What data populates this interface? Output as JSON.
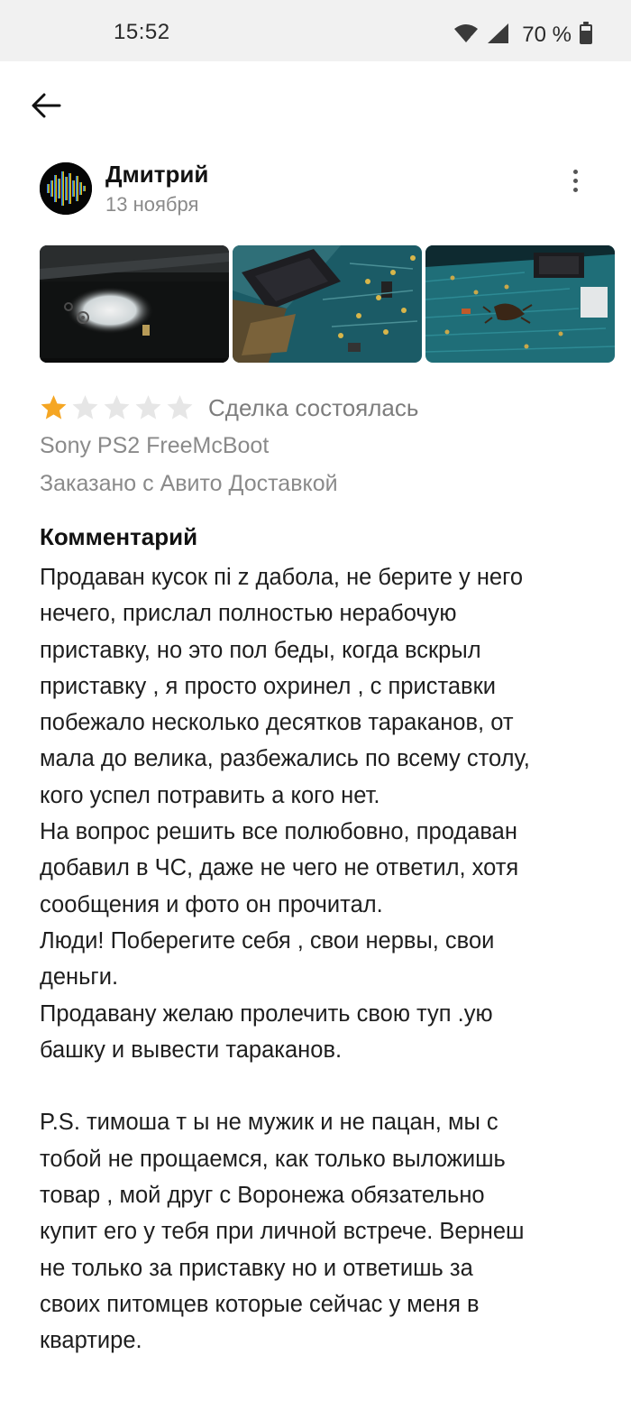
{
  "status_bar": {
    "time": "15:52",
    "battery": "70 %"
  },
  "review": {
    "author": "Дмитрий",
    "date": "13 ноября",
    "rating": 1,
    "max_rating": 5,
    "deal_status": "Сделка состоялась",
    "product": "Sony PS2 FreeMcBoot",
    "delivery": "Заказано с Авито Доставкой",
    "comment_title": "Комментарий",
    "comment_lines": [
      "Продаван кусок пі z дабола, не берите у него",
      "нечего, прислал полностью нерабочую",
      "приставку, но это пол беды, когда вскрыл",
      "приставку , я просто охринел , с приставки",
      "побежало несколько десятков тараканов, от",
      "мала до велика, разбежались по всему столу,",
      "кого успел потравить а кого нет.",
      "На вопрос решить все полюбовно, продаван",
      "добавил в ЧС, даже не чего не ответил, хотя",
      "сообщения и фото он прочитал.",
      "Люди! Поберегите себя , свои нервы, свои",
      "деньги.",
      "Продавану  желаю пролечить свою туп .ую",
      "башку и вывести тараканов.",
      "",
      "P.S.  тимоша т ы  не мужик и не пацан, мы с",
      "тобой не прощаемся, как только выложишь",
      "товар , мой друг с Воронежа обязательно",
      "купит его у тебя при личной встрече. Вернеш",
      "не только за приставку но и ответишь за",
      "своих питомцев которые сейчас у меня в",
      "квартире."
    ]
  },
  "icons": {
    "back": "arrow-left-icon",
    "more": "more-vertical-icon",
    "wifi": "wifi-icon",
    "signal": "signal-icon",
    "battery": "battery-icon",
    "star": "star-icon"
  },
  "colors": {
    "star_filled": "#f5a623",
    "star_empty": "#e6e6e6",
    "secondary_text": "#8a8a8a",
    "status_bar_bg": "#f1f1f1"
  }
}
